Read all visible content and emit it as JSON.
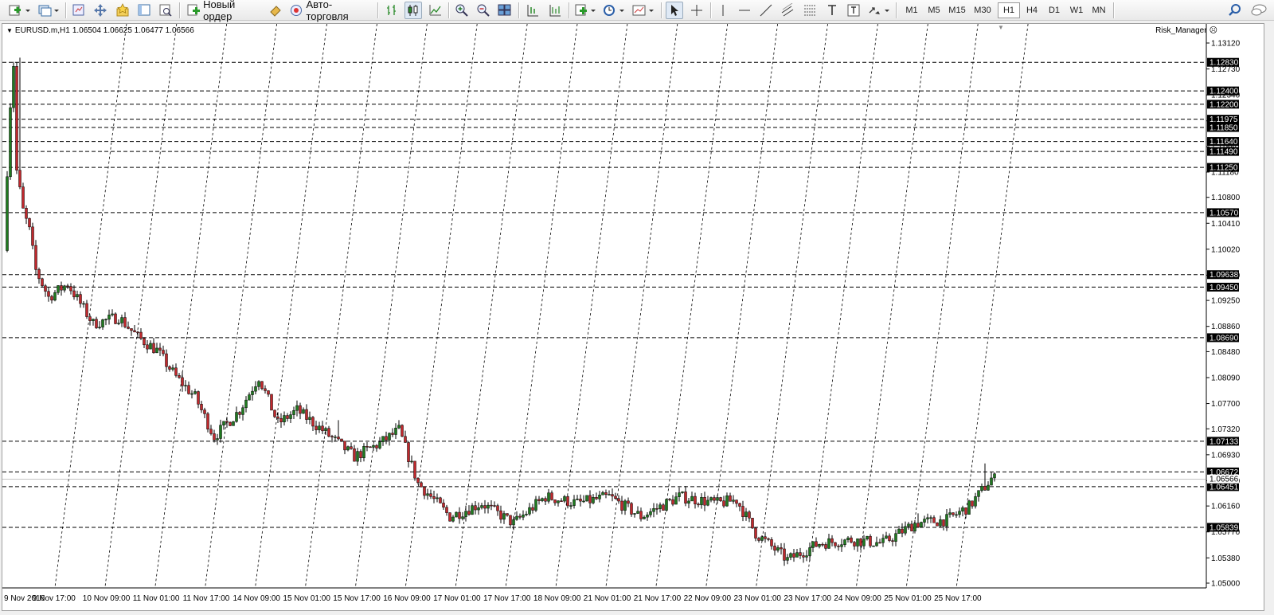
{
  "toolbar": {
    "new_order_label": "Новый ордер",
    "auto_trading_label": "Авто-торговля",
    "timeframes": [
      "M1",
      "M5",
      "M15",
      "M30",
      "H1",
      "H4",
      "D1",
      "W1",
      "MN"
    ],
    "active_timeframe": "H1"
  },
  "chart": {
    "symbol": "EURUSD.m,H1",
    "ohlc": "1.06504 1.06625 1.06477 1.06566",
    "indicator": "Risk_Manager",
    "background": "#ffffff",
    "bull_color": "#1f7a1f",
    "bear_color": "#c0282d",
    "wick_color": "#000000"
  },
  "price_scale": [
    "1.13120",
    "1.12730",
    "1.12340",
    "1.11950",
    "1.11560",
    "1.11180",
    "1.10800",
    "1.10410",
    "1.10020",
    "1.09630",
    "1.09250",
    "1.08860",
    "1.08480",
    "1.08090",
    "1.07700",
    "1.07320",
    "1.06930",
    "1.06540",
    "1.06160",
    "1.05770",
    "1.05380",
    "1.05000"
  ],
  "levels": [
    "1.12830",
    "1.12400",
    "1.12200",
    "1.11975",
    "1.11850",
    "1.11640",
    "1.11490",
    "1.11250",
    "1.10570",
    "1.09638",
    "1.09450",
    "1.08690",
    "1.07133",
    "1.06672",
    "1.06451",
    "1.05839"
  ],
  "current_price": "1.06566",
  "time_scale": [
    "9 Nov 2016",
    "9 Nov 17:00",
    "10 Nov 09:00",
    "11 Nov 01:00",
    "11 Nov 17:00",
    "14 Nov 09:00",
    "15 Nov 01:00",
    "15 Nov 17:00",
    "16 Nov 09:00",
    "17 Nov 01:00",
    "17 Nov 17:00",
    "18 Nov 09:00",
    "21 Nov 01:00",
    "21 Nov 17:00",
    "22 Nov 09:00",
    "23 Nov 01:00",
    "23 Nov 17:00",
    "24 Nov 09:00",
    "25 Nov 01:00",
    "25 Nov 17:00"
  ],
  "chart_data": {
    "type": "candlestick",
    "ylim": [
      1.05,
      1.1312
    ],
    "price_path": [
      [
        0,
        1.1
      ],
      [
        1,
        1.112
      ],
      [
        2,
        1.122
      ],
      [
        3,
        1.128
      ],
      [
        4,
        1.112
      ],
      [
        6,
        1.106
      ],
      [
        8,
        1.103
      ],
      [
        10,
        1.097
      ],
      [
        14,
        1.093
      ],
      [
        20,
        1.095
      ],
      [
        28,
        1.089
      ],
      [
        36,
        1.09
      ],
      [
        42,
        1.087
      ],
      [
        48,
        1.085
      ],
      [
        54,
        1.081
      ],
      [
        60,
        1.078
      ],
      [
        66,
        1.072
      ],
      [
        74,
        1.076
      ],
      [
        80,
        1.081
      ],
      [
        86,
        1.074
      ],
      [
        92,
        1.076
      ],
      [
        100,
        1.073
      ],
      [
        110,
        1.069
      ],
      [
        118,
        1.071
      ],
      [
        124,
        1.073
      ],
      [
        130,
        1.065
      ],
      [
        140,
        1.06
      ],
      [
        150,
        1.062
      ],
      [
        160,
        1.059
      ],
      [
        170,
        1.063
      ],
      [
        180,
        1.062
      ],
      [
        190,
        1.063
      ],
      [
        200,
        1.06
      ],
      [
        212,
        1.063
      ],
      [
        224,
        1.062
      ],
      [
        230,
        1.0625
      ],
      [
        236,
        1.0575
      ],
      [
        246,
        1.0535
      ],
      [
        256,
        1.056
      ],
      [
        266,
        1.0565
      ],
      [
        276,
        1.056
      ],
      [
        286,
        1.059
      ],
      [
        296,
        1.0595
      ],
      [
        303,
        1.0615
      ],
      [
        310,
        1.0657
      ]
    ],
    "spikes": [
      [
        4,
        1.129
      ],
      [
        104,
        1.0745
      ],
      [
        286,
        1.0605
      ],
      [
        307,
        1.068
      ]
    ]
  }
}
